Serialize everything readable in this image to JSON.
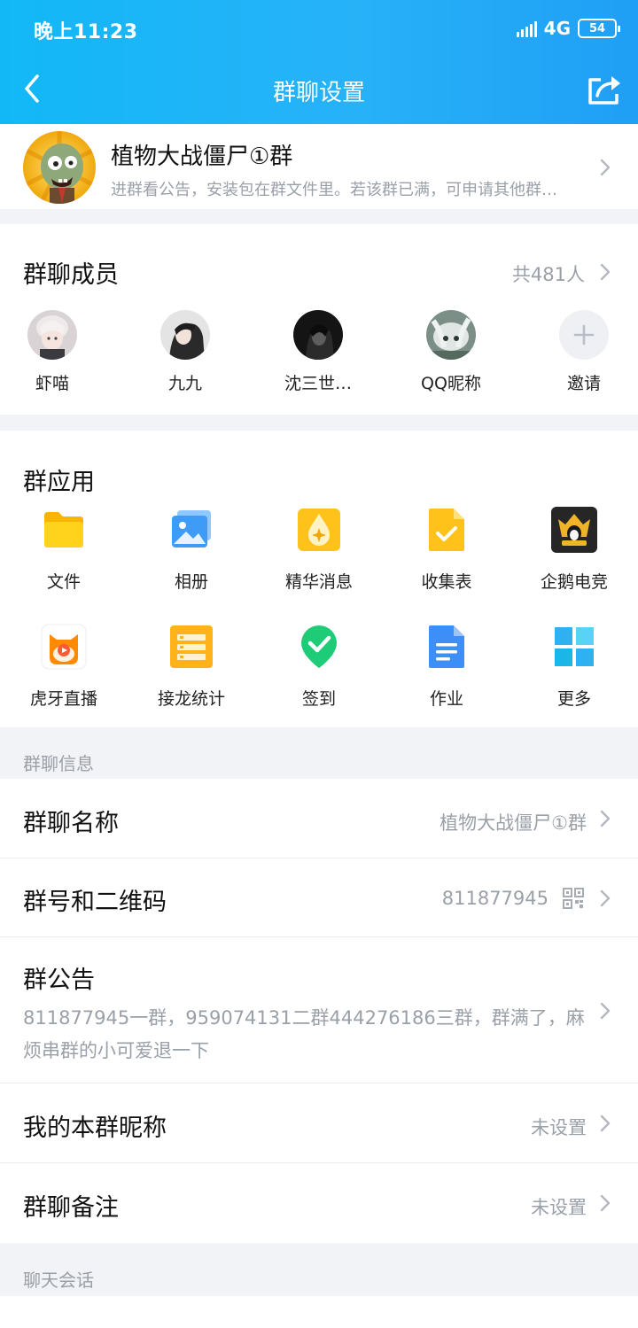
{
  "status_bar": {
    "time": "晚上11:23",
    "network": "4G",
    "battery": "54"
  },
  "nav": {
    "title": "群聊设置"
  },
  "group": {
    "name": "植物大战僵尸①群",
    "description": "进群看公告，安装包在群文件里。若该群已满，可申请其他群…"
  },
  "members": {
    "title": "群聊成员",
    "count_label": "共481人",
    "list": [
      {
        "name": "虾喵"
      },
      {
        "name": "九九"
      },
      {
        "name": "沈三世…"
      },
      {
        "name": "QQ昵称"
      }
    ],
    "invite_label": "邀请"
  },
  "apps": {
    "title": "群应用",
    "items": [
      {
        "label": "文件",
        "icon": "folder-icon"
      },
      {
        "label": "相册",
        "icon": "album-icon"
      },
      {
        "label": "精华消息",
        "icon": "essence-icon"
      },
      {
        "label": "收集表",
        "icon": "form-icon"
      },
      {
        "label": "企鹅电竞",
        "icon": "esports-icon"
      },
      {
        "label": "虎牙直播",
        "icon": "huya-icon"
      },
      {
        "label": "接龙统计",
        "icon": "solitaire-icon"
      },
      {
        "label": "签到",
        "icon": "checkin-icon"
      },
      {
        "label": "作业",
        "icon": "homework-icon"
      },
      {
        "label": "更多",
        "icon": "more-grid-icon"
      }
    ]
  },
  "info_section": {
    "title": "群聊信息",
    "name_label": "群聊名称",
    "name_value": "植物大战僵尸①群",
    "number_label": "群号和二维码",
    "number_value": "811877945",
    "notice_label": "群公告",
    "notice_text": "811877945一群，959074131二群444276186三群，群满了，麻烦串群的小可爱退一下",
    "nickname_label": "我的本群昵称",
    "nickname_value": "未设置",
    "remark_label": "群聊备注",
    "remark_value": "未设置"
  },
  "chat_section": {
    "title": "聊天会话"
  },
  "colors": {
    "header_blue": "#1fb1f7",
    "muted_text": "#9aa0a8",
    "background": "#f2f3f6"
  }
}
